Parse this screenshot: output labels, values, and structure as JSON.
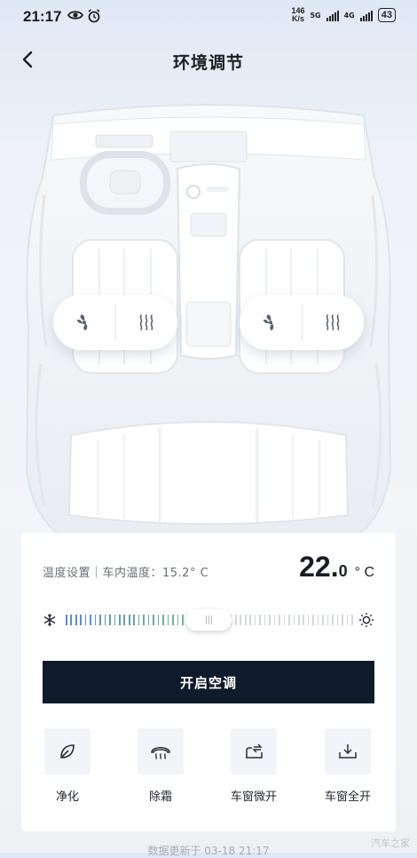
{
  "status_bar": {
    "time": "21:17",
    "net_speed_top": "146",
    "net_speed_bottom": "K/s",
    "sim1": "5G",
    "sim2": "4G",
    "battery": "43"
  },
  "header": {
    "title": "环境调节"
  },
  "car": {
    "left_seat_icons": [
      "fan-icon",
      "seat-heat-icon"
    ],
    "right_seat_icons": [
      "fan-icon",
      "seat-heat-icon"
    ]
  },
  "climate": {
    "label": "温度设置｜车内温度：15.2° C",
    "temp_value": "22.",
    "temp_decimal": "0",
    "temp_unit": "° C",
    "slider_level": 0.5,
    "cold_color": "#5b86c9",
    "warm_color": "#7cc38a",
    "inactive_color": "#d4d7dc"
  },
  "ac_button": {
    "label": "开启空调",
    "color": "#0f1b2a"
  },
  "functions": [
    {
      "label": "净化",
      "icon": "leaf-icon"
    },
    {
      "label": "除霜",
      "icon": "defrost-icon"
    },
    {
      "label": "车窗微开",
      "icon": "window-vent-icon"
    },
    {
      "label": "车窗全开",
      "icon": "window-open-icon"
    }
  ],
  "footer": {
    "updated": "数据更新于 03-18 21:17",
    "watermark": "汽车之家"
  }
}
